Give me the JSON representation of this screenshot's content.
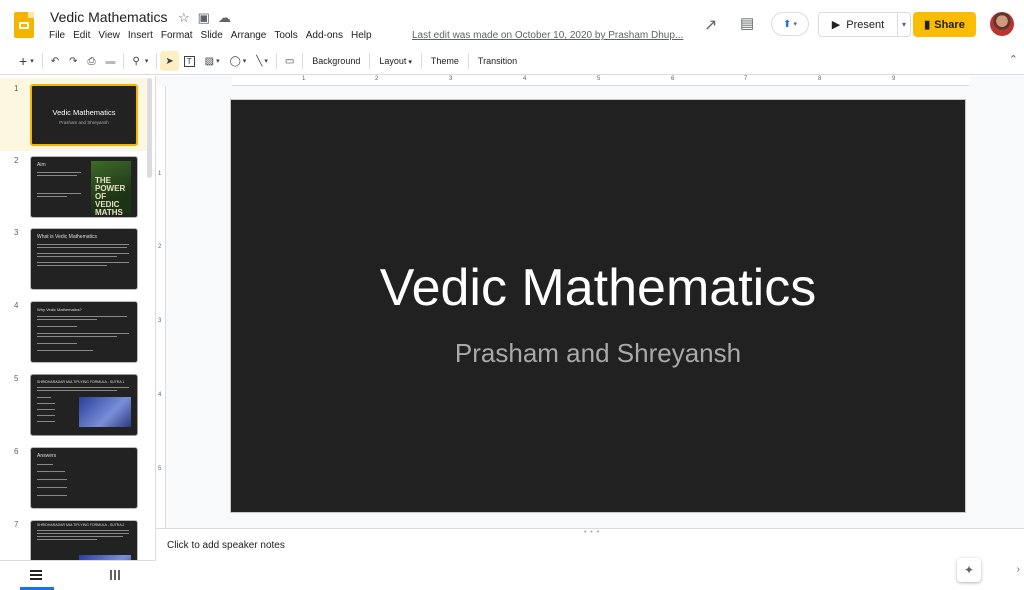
{
  "app": {
    "doc_title": "Vedic Mathematics",
    "menus": [
      "File",
      "Edit",
      "View",
      "Insert",
      "Format",
      "Slide",
      "Arrange",
      "Tools",
      "Add-ons",
      "Help"
    ],
    "last_edit": "Last edit was made on October 10, 2020 by Prasham Dhup...",
    "present_label": "Present",
    "share_label": "Share"
  },
  "toolbar": {
    "background_label": "Background",
    "layout_label": "Layout",
    "theme_label": "Theme",
    "transition_label": "Transition"
  },
  "ruler": {
    "h_ticks": [
      "1",
      "2",
      "3",
      "4",
      "5",
      "6",
      "7",
      "8",
      "9"
    ],
    "v_ticks": [
      "1",
      "2",
      "3",
      "4",
      "5"
    ]
  },
  "filmstrip": {
    "slides": [
      {
        "num": "1",
        "title": "Vedic Mathematics",
        "subtitle": "Prasham and Shreyansh"
      },
      {
        "num": "2",
        "title": "Aim",
        "book_text": "THE POWER OF VEDIC MATHS"
      },
      {
        "num": "3",
        "title": "What is Vedic Mathematics"
      },
      {
        "num": "4",
        "title": "Why Vedic Mathematics?"
      },
      {
        "num": "5",
        "title": "SHRIDHARADAR MULTIPLYING FORMULA - SUTRA 1"
      },
      {
        "num": "6",
        "title": "Answers"
      },
      {
        "num": "7",
        "title": "SHRIDHARADAR MULTIPLYING FORMULA - SUTRA 2"
      }
    ]
  },
  "slide": {
    "title": "Vedic Mathematics",
    "subtitle": "Prasham and Shreyansh"
  },
  "notes": {
    "placeholder": "Click to add speaker notes"
  },
  "colors": {
    "accent": "#f4b400",
    "share": "#fbbc04",
    "slide_bg": "#212121"
  }
}
